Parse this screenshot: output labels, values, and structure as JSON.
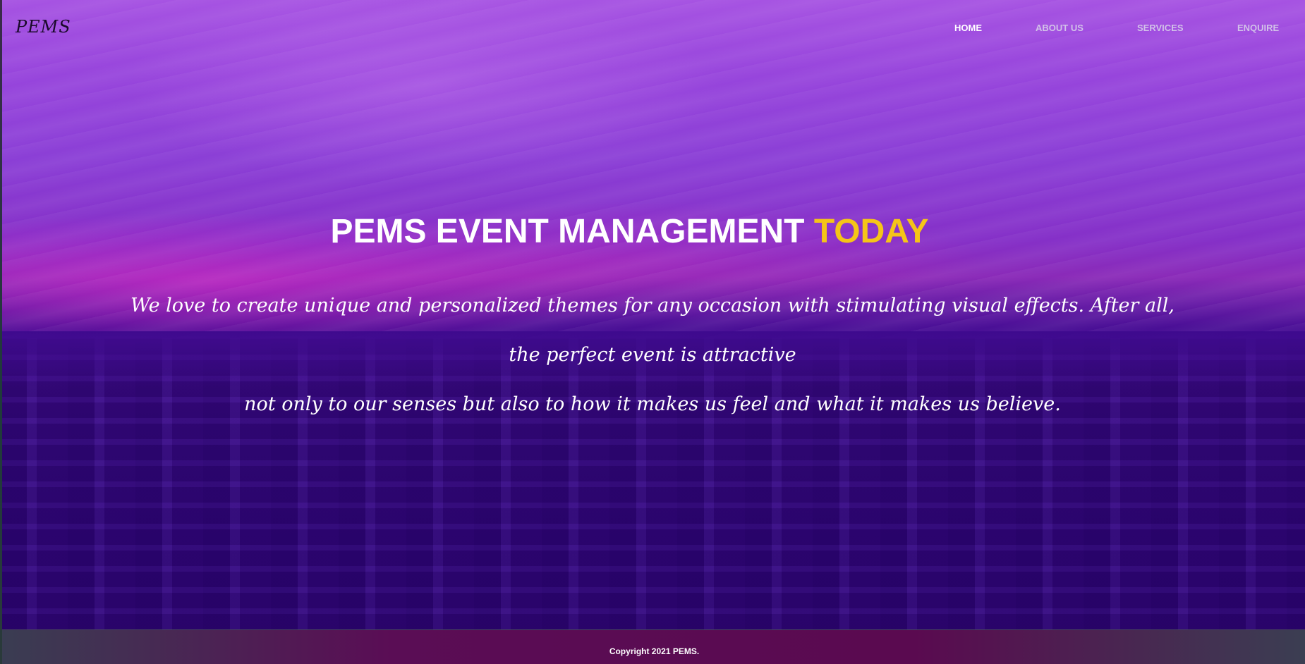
{
  "brand": {
    "logo_text": "PEMS"
  },
  "nav": {
    "items": [
      {
        "label": "HOME",
        "active": true
      },
      {
        "label": "ABOUT US",
        "active": false
      },
      {
        "label": "SERVICES",
        "active": false
      },
      {
        "label": "ENQUIRE",
        "active": false
      }
    ]
  },
  "hero": {
    "headline_main": "PEMS EVENT MANAGEMENT ",
    "headline_accent": "TODAY",
    "tagline_lines": [
      "We love to create unique and personalized themes for any occasion with stimulating visual effects. After all,",
      "the perfect event is attractive",
      "not only to our senses but also to how it makes us feel and what it makes us believe."
    ]
  },
  "footer": {
    "copyright": "Copyright 2021 PEMS."
  },
  "colors": {
    "accent": "#f5c518",
    "text_primary": "#ffffff",
    "nav_inactive": "#d2c2e8",
    "hero_top": "#a653e2",
    "hero_bottom": "#32057f"
  }
}
